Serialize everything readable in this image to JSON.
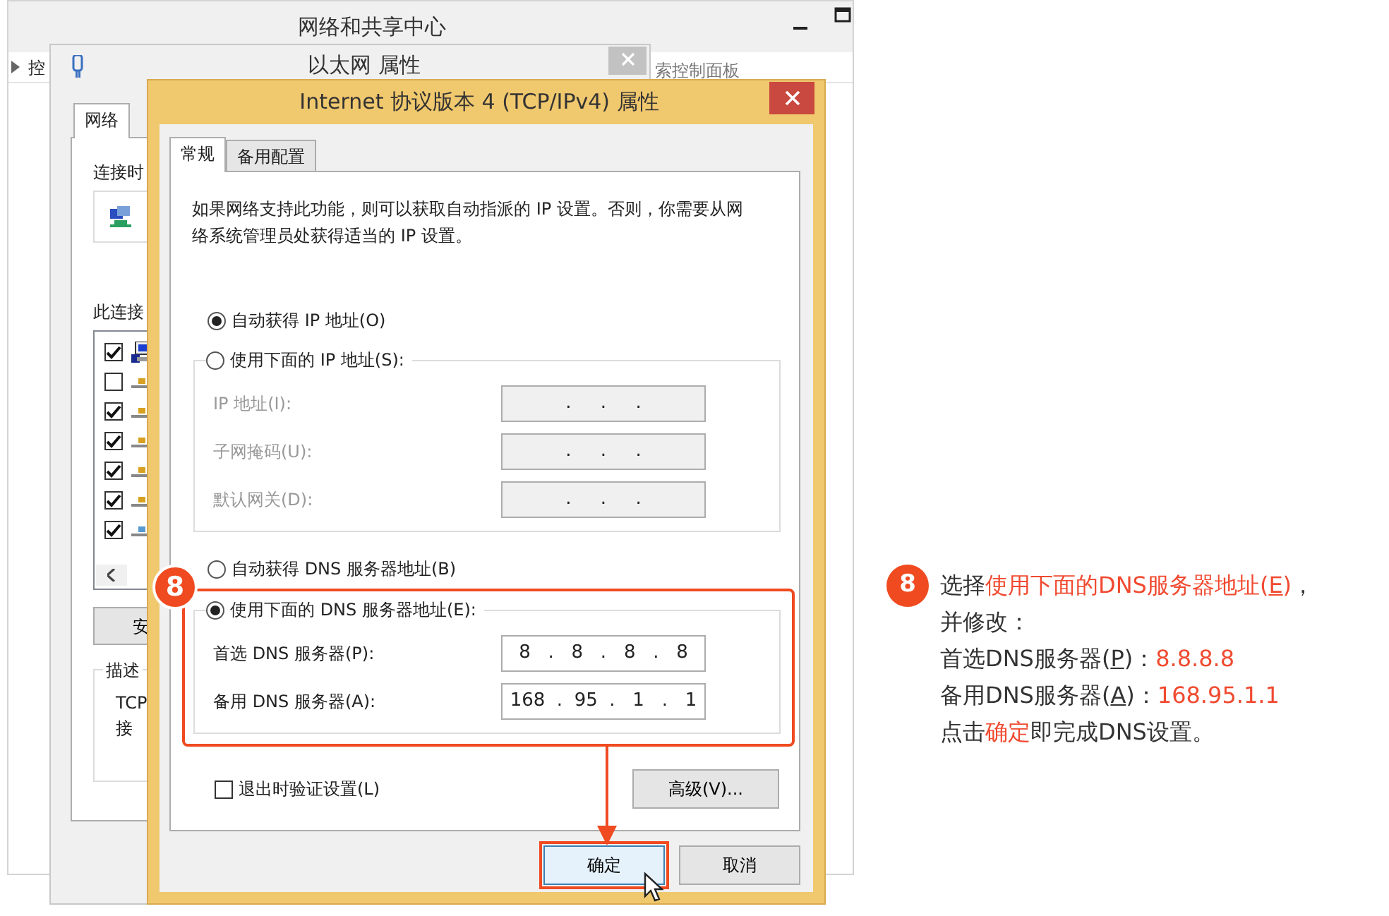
{
  "background_window": {
    "title": "网络和共享中心",
    "breadcrumb": "控",
    "search_text": "索控制面板"
  },
  "ethernet_window": {
    "title": "以太网 属性",
    "tabs": [
      {
        "label": "网络",
        "selected": true
      }
    ],
    "connect_label": "连接时",
    "components_label": "此连接",
    "components": [
      {
        "kind": "client",
        "checked": true
      },
      {
        "kind": "protocol",
        "checked": false
      },
      {
        "kind": "protocol",
        "checked": true
      },
      {
        "kind": "protocol",
        "checked": true
      },
      {
        "kind": "protocol",
        "checked": true
      },
      {
        "kind": "protocol",
        "checked": true
      },
      {
        "kind": "protocol-blue",
        "checked": true
      }
    ],
    "install_button": "安",
    "description_title": "描述",
    "description_lines": [
      "TCP",
      "接"
    ]
  },
  "ipv4_dialog": {
    "title": "Internet 协议版本 4 (TCP/IPv4) 属性",
    "tabs": [
      {
        "label": "常规",
        "selected": true
      },
      {
        "label": "备用配置",
        "selected": false
      }
    ],
    "intro": "如果网络支持此功能，则可以获取自动指派的 IP 设置。否则，你需要从网络系统管理员处获得适当的 IP 设置。",
    "ip_mode": [
      {
        "label": "自动获得 IP 地址(O)",
        "selected": true
      },
      {
        "label": "使用下面的 IP 地址(S):",
        "selected": false
      }
    ],
    "ip_fields": [
      {
        "label": "IP 地址(I):",
        "value": ".     .     .",
        "disabled": true
      },
      {
        "label": "子网掩码(U):",
        "value": ".     .     .",
        "disabled": true
      },
      {
        "label": "默认网关(D):",
        "value": ".     .     .",
        "disabled": true
      }
    ],
    "dns_mode": [
      {
        "label": "自动获得 DNS 服务器地址(B)",
        "selected": false
      },
      {
        "label": "使用下面的 DNS 服务器地址(E):",
        "selected": true
      }
    ],
    "dns_fields": [
      {
        "label": "首选 DNS 服务器(P):",
        "value": "8   .   8   .   8   .   8",
        "disabled": false
      },
      {
        "label": "备用 DNS 服务器(A):",
        "value": "168  .  95  .   1   .   1",
        "disabled": false
      }
    ],
    "validate": {
      "label": "退出时验证设置(L)",
      "checked": false
    },
    "advanced_button": "高级(V)...",
    "buttons": [
      {
        "label": "确定",
        "highlighted": true
      },
      {
        "label": "取消",
        "highlighted": false
      }
    ],
    "step_badge": "8"
  },
  "callout": {
    "step": "8",
    "lines": [
      [
        {
          "text": "选择",
          "kind": "plain"
        },
        {
          "text": "使用下面的DNS服务器地址(",
          "kind": "accent"
        },
        {
          "text": "E",
          "kind": "accent-key"
        },
        {
          "text": ")",
          "kind": "accent"
        },
        {
          "text": "，",
          "kind": "plain"
        }
      ],
      [
        {
          "text": "并修改：",
          "kind": "plain"
        }
      ],
      [
        {
          "text": "首选DNS服务器(",
          "kind": "plain"
        },
        {
          "text": "P",
          "kind": "key"
        },
        {
          "text": ")：",
          "kind": "plain"
        },
        {
          "text": "8.8.8.8",
          "kind": "accent"
        }
      ],
      [
        {
          "text": "备用DNS服务器(",
          "kind": "plain"
        },
        {
          "text": "A",
          "kind": "key"
        },
        {
          "text": ")：",
          "kind": "plain"
        },
        {
          "text": "168.95.1.1",
          "kind": "accent"
        }
      ],
      [
        {
          "text": "点击",
          "kind": "plain"
        },
        {
          "text": "确定",
          "kind": "accent"
        },
        {
          "text": "即完成DNS设置。",
          "kind": "plain"
        }
      ]
    ]
  }
}
